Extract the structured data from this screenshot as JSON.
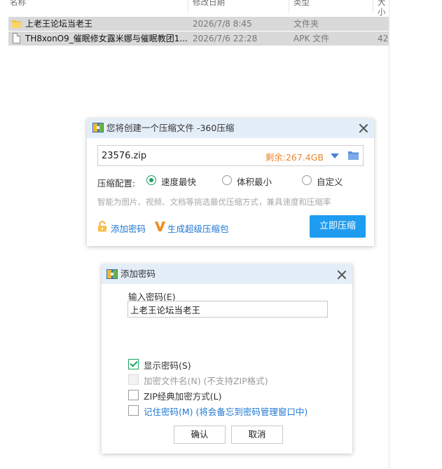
{
  "explorer": {
    "columns": {
      "name": "名称",
      "modified": "修改日期",
      "type": "类型",
      "size": "大小"
    },
    "rows": [
      {
        "name": "上老王论坛当老王",
        "modified": "2026/7/8 8:45",
        "type": "文件夹",
        "size": "",
        "icon": "folder-icon"
      },
      {
        "name": "TH8xonO9_催眠修女露米娜与催眠教团1...",
        "modified": "2026/7/6 22:28",
        "type": "APK 文件",
        "size": "42",
        "icon": "file-icon"
      }
    ]
  },
  "compress_dialog": {
    "title": "您将创建一个压缩文件 -360压缩",
    "filename": "23576.zip",
    "remaining": "剩余:267.4GB",
    "config_label": "压缩配置:",
    "options": [
      {
        "label": "速度最快",
        "selected": true
      },
      {
        "label": "体积最小",
        "selected": false
      },
      {
        "label": "自定义",
        "selected": false
      }
    ],
    "hint": "智能为图片、视频、文档等挑选最优压缩方式，兼具速度和压缩率",
    "add_password": "添加密码",
    "super_package": "生成超级压缩包",
    "compress_button": "立即压缩",
    "accent_color": "#1e9cf0",
    "remain_color": "#e8862d"
  },
  "password_dialog": {
    "title": "添加密码",
    "input_label": "输入密码(E)",
    "password_value": "上老王论坛当老王",
    "checkboxes": [
      {
        "label": "显示密码(S)",
        "checked": true,
        "disabled": false
      },
      {
        "label": "加密文件名(N) (不支持ZIP格式)",
        "checked": false,
        "disabled": true
      },
      {
        "label": "ZIP经典加密方式(L)",
        "checked": false,
        "disabled": false
      },
      {
        "label": "记住密码(M) (将会备忘到密码管理窗口中)",
        "checked": false,
        "disabled": false
      }
    ],
    "ok_button": "确认",
    "cancel_button": "取消"
  }
}
